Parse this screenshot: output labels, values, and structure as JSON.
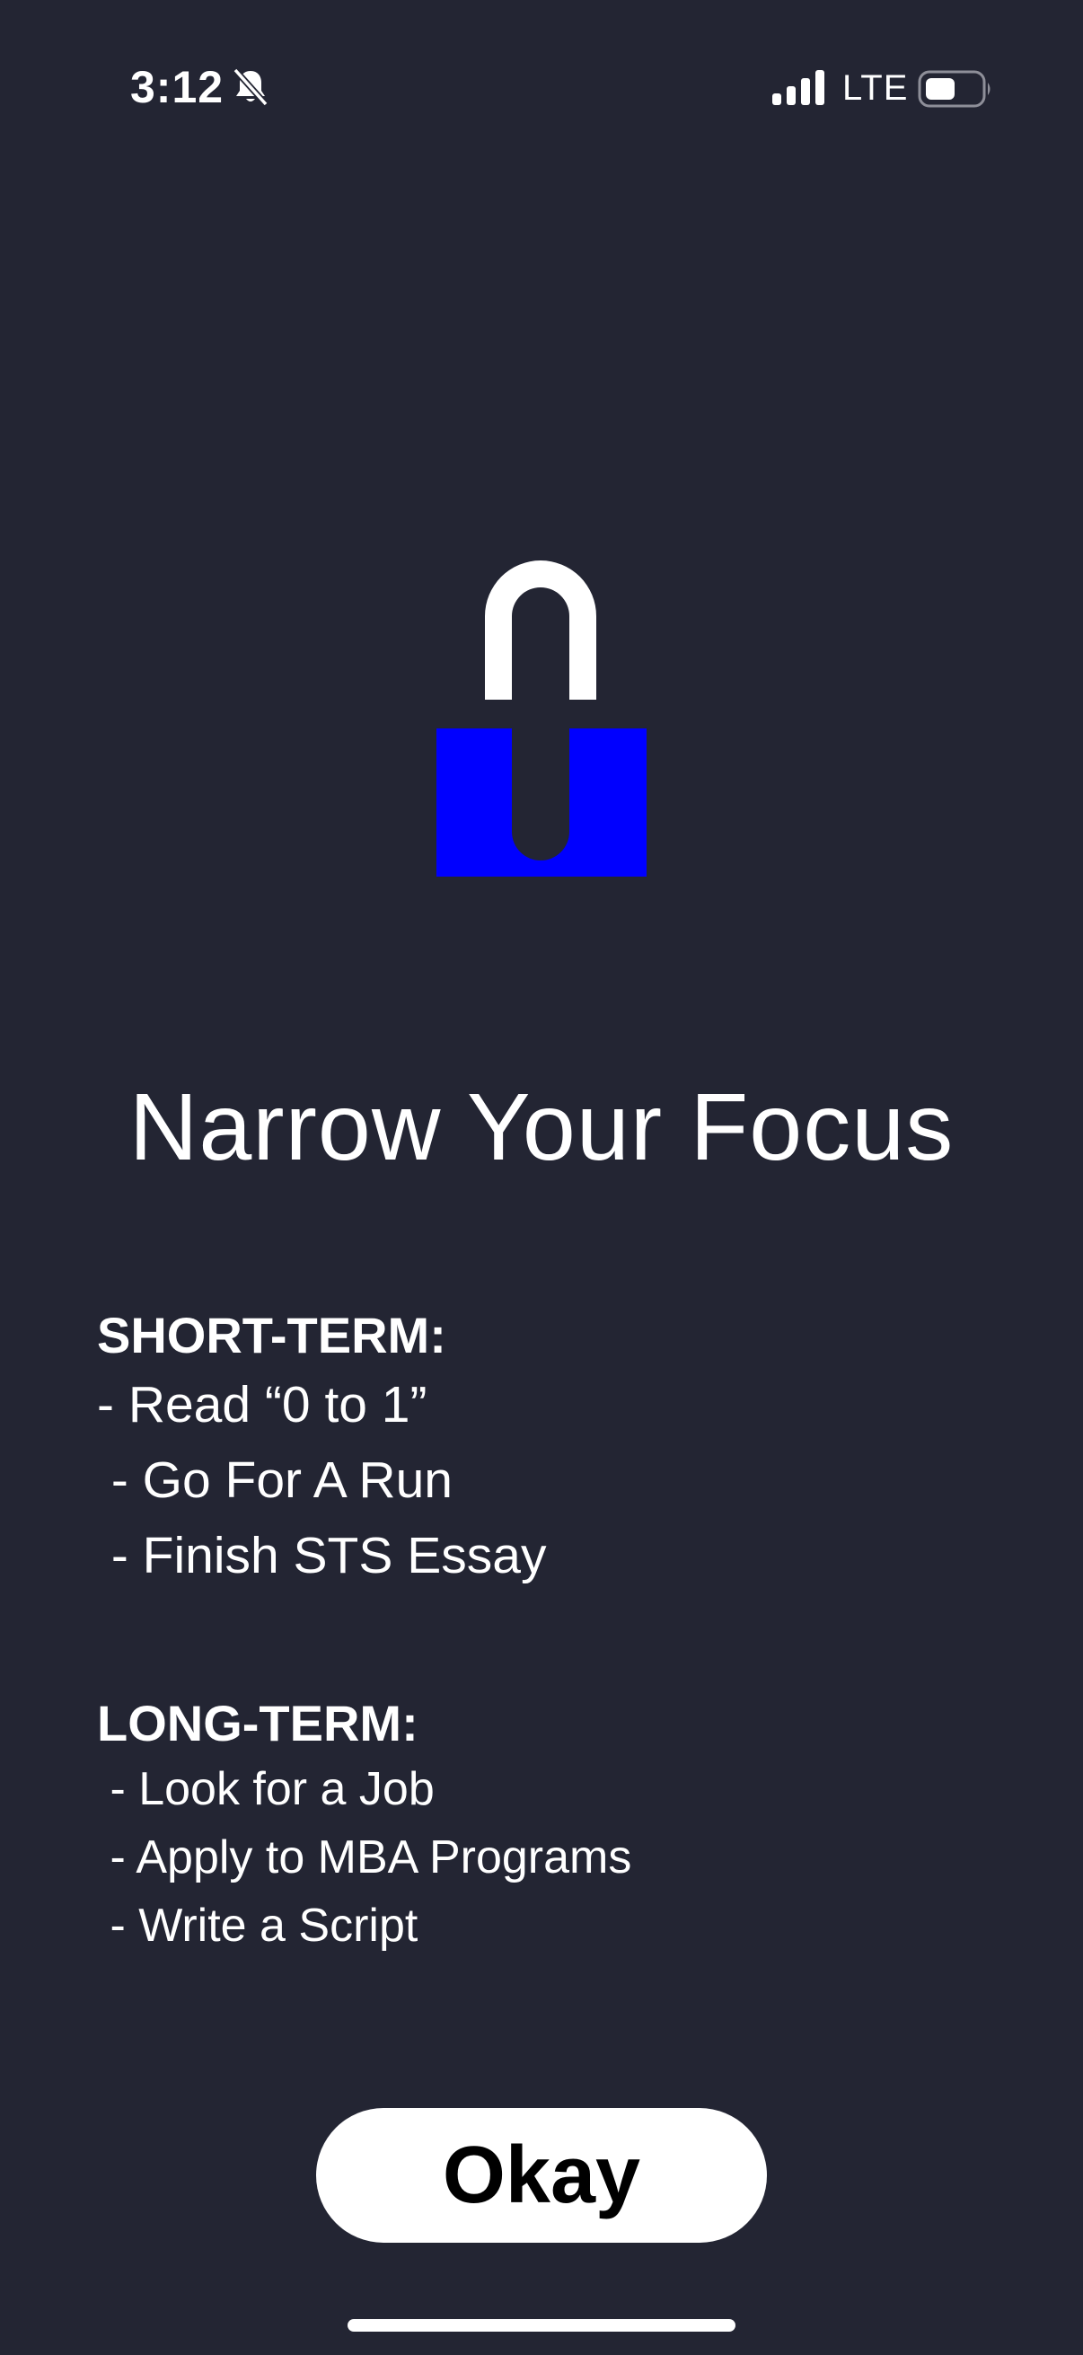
{
  "status_bar": {
    "time": "3:12",
    "network": "LTE",
    "icons": [
      "bell-slash-icon",
      "cellular-signal-icon",
      "battery-icon"
    ]
  },
  "hero": {
    "icon": "padlock-icon",
    "colors": {
      "shackle": "#ffffff",
      "body": "#0000ff",
      "background": "#232533"
    }
  },
  "title": "Narrow Your Focus",
  "short_term": {
    "heading": "SHORT-TERM:",
    "items": [
      "- Read “0 to 1”",
      " - Go For A Run",
      " - Finish STS Essay"
    ]
  },
  "long_term": {
    "heading": "LONG-TERM:",
    "items": [
      " - Look for a Job",
      " - Apply to MBA Programs",
      " - Write a Script"
    ]
  },
  "button": {
    "label": "Okay"
  }
}
